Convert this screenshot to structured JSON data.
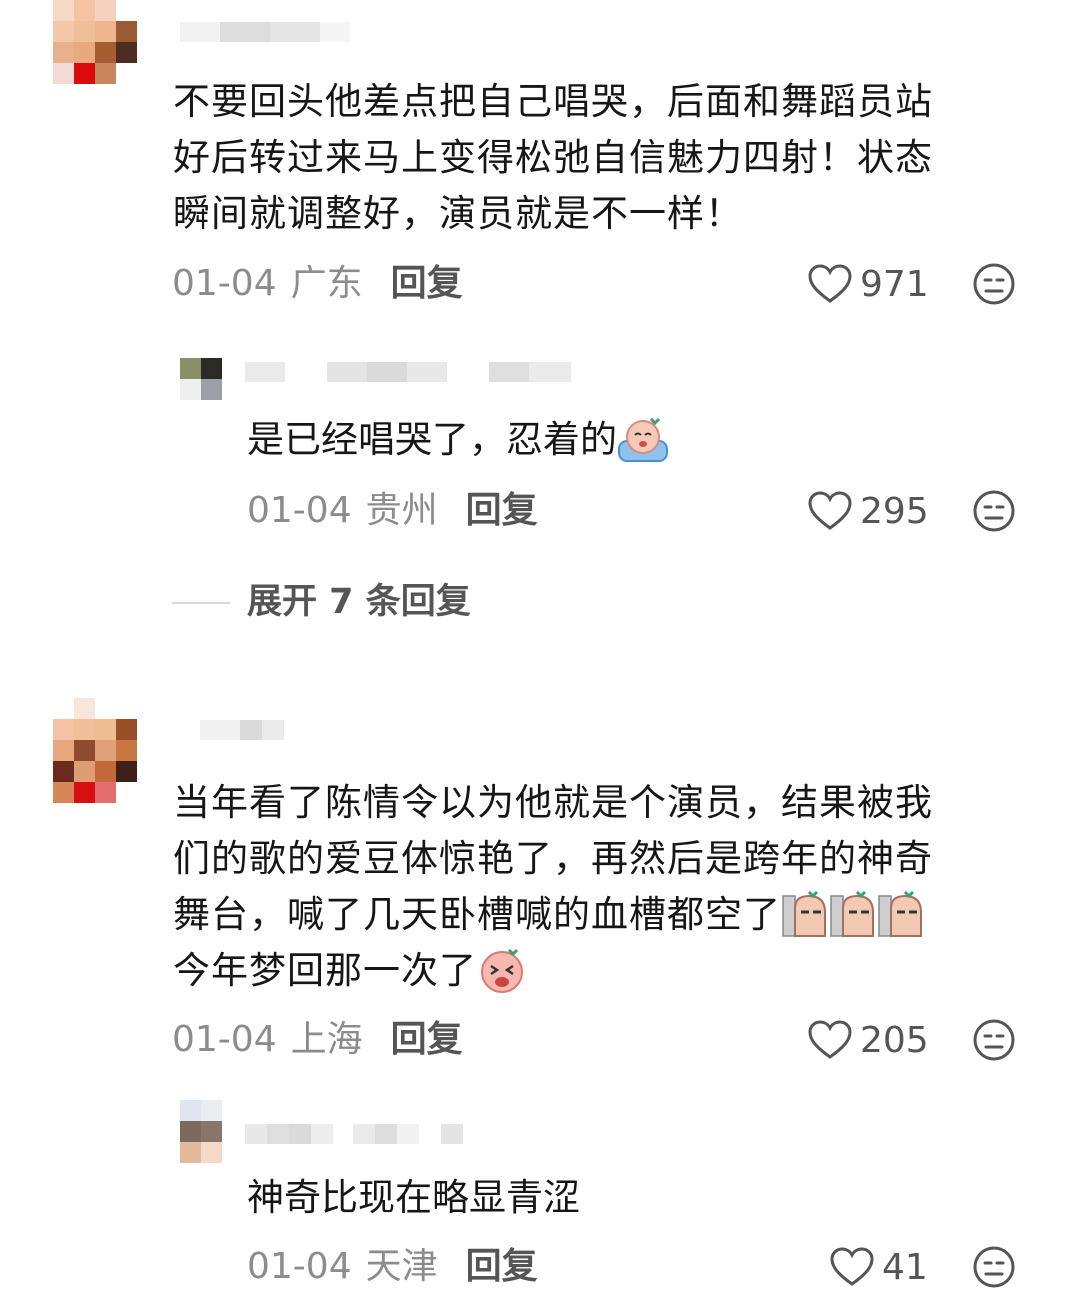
{
  "comments": [
    {
      "text": "不要回头他差点把自己唱哭，后面和舞蹈员站\n好后转过来马上变得松弛自信魅力四射！状态\n瞬间就调整好，演员就是不一样！",
      "date": "01-04",
      "region": "广东",
      "reply_label": "回复",
      "likes": "971",
      "replies": [
        {
          "text": "是已经唱哭了，忍着的",
          "date": "01-04",
          "region": "贵州",
          "reply_label": "回复",
          "likes": "295"
        }
      ],
      "expand_label": "展开 7 条回复"
    },
    {
      "text_lines": [
        "当年看了陈情令以为他就是个演员，结果被我",
        "们的歌的爱豆体惊艳了，再然后是跨年的神奇",
        "舞台，喊了几天卧槽喊的血槽都空了",
        "今年梦回那一次了"
      ],
      "date": "01-04",
      "region": "上海",
      "reply_label": "回复",
      "likes": "205",
      "replies": [
        {
          "text": "神奇比现在略显青涩",
          "date": "01-04",
          "region": "天津",
          "reply_label": "回复",
          "likes": "41"
        }
      ]
    }
  ],
  "icons": {
    "like": "heart-outline-icon",
    "dislike": "meh-face-icon"
  },
  "colors": {
    "meta_gray": "#8c8c8c",
    "text": "#161616"
  }
}
